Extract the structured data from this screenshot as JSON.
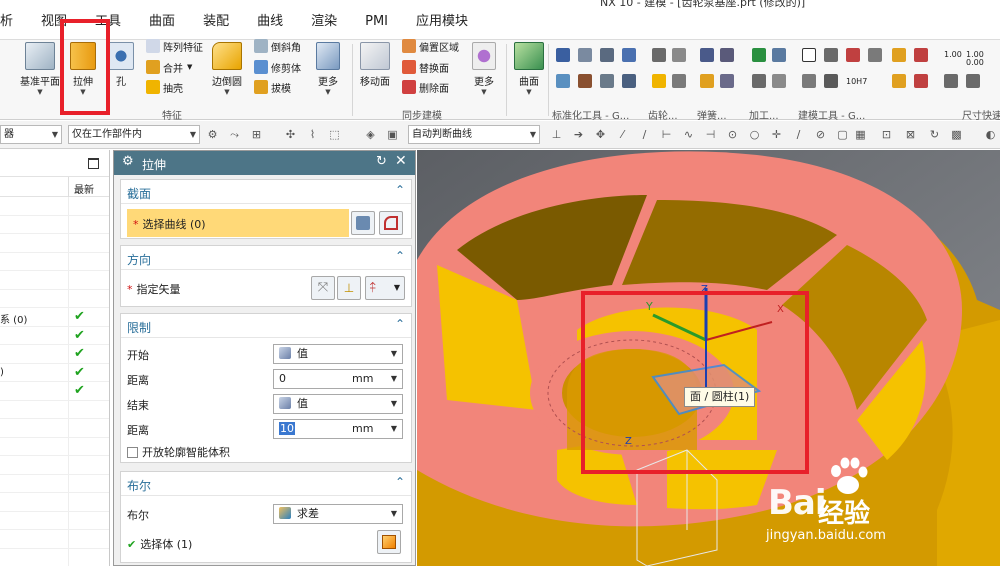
{
  "window": {
    "title": "NX 10 - 建模 - [齿轮泵基座.prt (修改的)]"
  },
  "menu": {
    "items": [
      "析",
      "视图",
      "工具",
      "曲面",
      "装配",
      "曲线",
      "渲染",
      "PMI",
      "应用模块"
    ]
  },
  "ribbon": {
    "datum_plane": "基准平面",
    "extrude": "拉伸",
    "hole": "孔",
    "pattern_feature": "阵列特征",
    "unite": "合并",
    "shell": "抽壳",
    "edge_blend": "边倒圆",
    "chamfer": "倒斜角",
    "trim_body": "修剪体",
    "draft": "拔模",
    "more1": "更多",
    "move_face": "移动面",
    "offset_region": "偏置区域",
    "replace_face": "替换面",
    "delete_face": "删除面",
    "more2": "更多",
    "surface": "曲面",
    "group_feature": "特征",
    "group_sync": "同步建模",
    "group_std": "标准化工具 - G...",
    "group_gear": "齿轮...",
    "group_spring": "弹簧...",
    "group_machining": "加工...",
    "group_modeling_tools": "建模工具 - G...",
    "group_dim": "尺寸快速",
    "dim_value_1": "1.00",
    "dim_value_2": "1.00",
    "dim_value_3": "0.00",
    "tag_10h7": "10H7"
  },
  "cmdbar": {
    "filter_value": "器",
    "scope_value": "仅在工作部件内",
    "curve_rule": "自动判断曲线"
  },
  "navigator": {
    "col_latest": "最新",
    "rows": [
      {
        "text": "",
        "check": false
      },
      {
        "text": "",
        "check": false
      },
      {
        "text": "",
        "check": false
      },
      {
        "text": "",
        "check": false
      },
      {
        "text": "",
        "check": false
      },
      {
        "text": "",
        "check": false
      },
      {
        "text": "系 (0)",
        "check": true
      },
      {
        "text": "",
        "check": true
      },
      {
        "text": "",
        "check": true
      },
      {
        "text": ")",
        "check": true
      },
      {
        "text": "",
        "check": true
      },
      {
        "text": "",
        "check": false
      },
      {
        "text": "",
        "check": false
      },
      {
        "text": "",
        "check": false
      },
      {
        "text": "",
        "check": false
      },
      {
        "text": "",
        "check": false
      },
      {
        "text": "",
        "check": false
      },
      {
        "text": "",
        "check": false
      },
      {
        "text": "",
        "check": false
      },
      {
        "text": "",
        "check": false
      }
    ]
  },
  "dialog": {
    "title": "拉伸",
    "section": {
      "header": "截面",
      "select_curve": "选择曲线 (0)"
    },
    "direction": {
      "header": "方向",
      "specify_vector": "指定矢量"
    },
    "limits": {
      "header": "限制",
      "start_label": "开始",
      "start_option": "值",
      "start_distance_label": "距离",
      "start_distance": "0",
      "start_unit": "mm",
      "end_label": "结束",
      "end_option": "值",
      "end_distance_label": "距离",
      "end_distance": "10",
      "end_unit": "mm",
      "open_profile": "开放轮廓智能体积"
    },
    "boolean": {
      "header": "布尔",
      "boolean_label": "布尔",
      "boolean_value": "求差",
      "select_body": "选择体 (1)"
    }
  },
  "viewport": {
    "tooltip": "面 / 圆柱(1)",
    "axis_x": "X",
    "axis_y": "Y",
    "axis_z": "Z",
    "axis_z2": "Z"
  },
  "watermark": {
    "brand": "Bai",
    "brand2": "经验",
    "url": "jingyan.baidu.com"
  },
  "colors": {
    "dialog_title": "#4d7587",
    "accent_blue": "#2a6f9a",
    "selection_yellow": "#ffd978",
    "model_orange": "#f0b400",
    "model_salmon": "#f08070",
    "highlight_red": "#e8202a"
  }
}
